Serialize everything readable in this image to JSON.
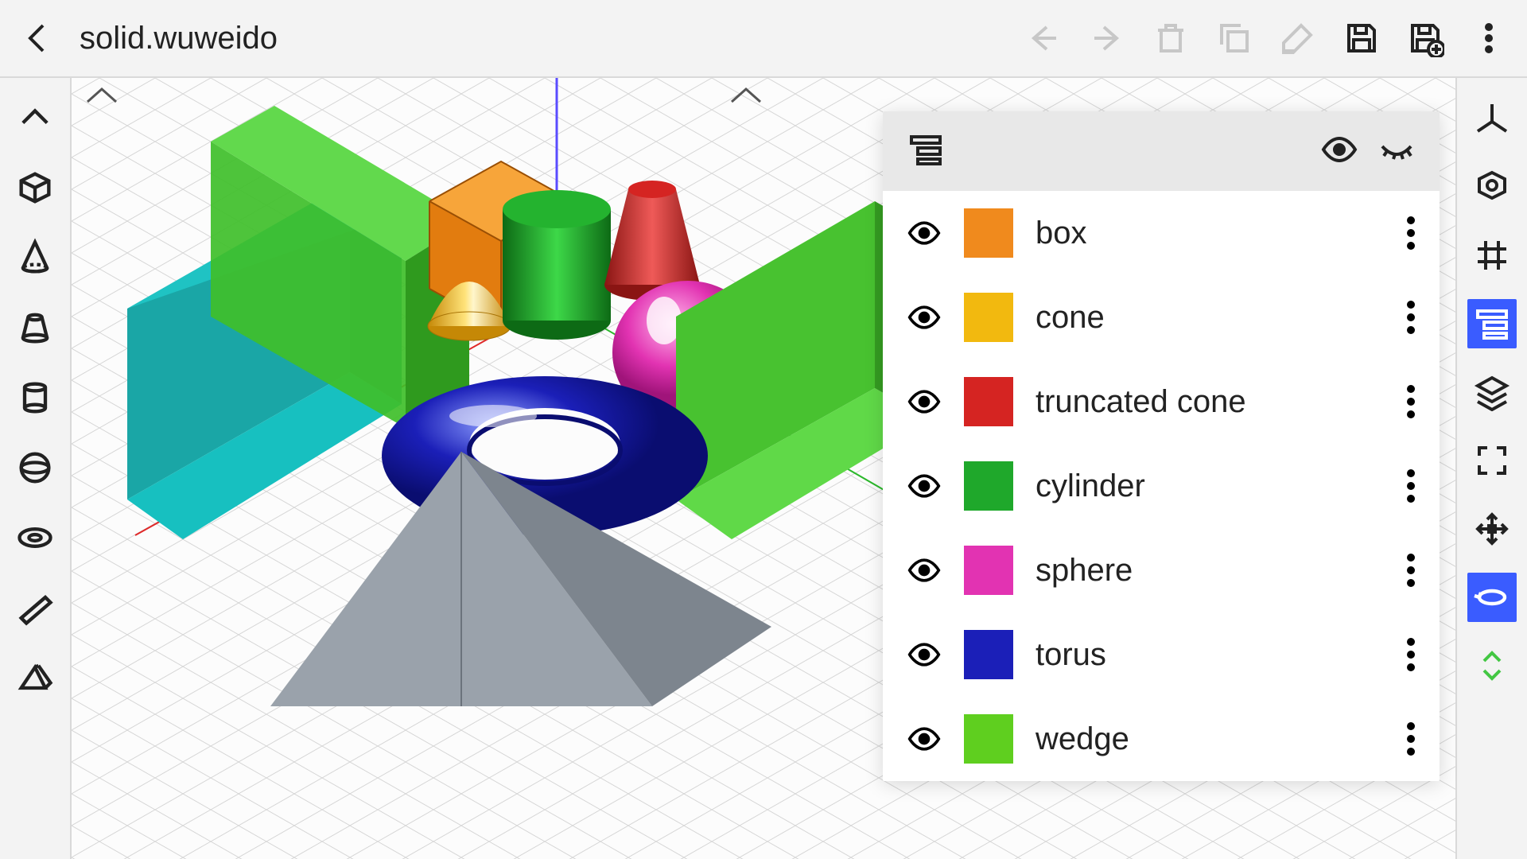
{
  "header": {
    "title": "solid.wuweido"
  },
  "toolbar_top": {
    "back": "back-icon",
    "undo": "undo-icon",
    "redo": "redo-icon",
    "delete": "trash-icon",
    "duplicate": "duplicate-icon",
    "edit": "edit-icon",
    "save": "save-icon",
    "save_as": "save-as-icon",
    "menu": "menu-icon"
  },
  "left_tools": [
    "collapse-up",
    "box-tool",
    "cone-tool",
    "truncated-cone-tool",
    "cylinder-tool",
    "sphere-tool",
    "torus-tool",
    "wedge-tool",
    "pyramid-tool"
  ],
  "right_tools": [
    {
      "name": "axes-tool",
      "active": false
    },
    {
      "name": "frame-tool",
      "active": false
    },
    {
      "name": "grid-tool",
      "active": false
    },
    {
      "name": "outline-tool",
      "active": true
    },
    {
      "name": "layers-tool",
      "active": false
    },
    {
      "name": "fullscreen-tool",
      "active": false
    },
    {
      "name": "move-tool",
      "active": false
    },
    {
      "name": "rotate-tool",
      "active": true
    },
    {
      "name": "scale-tool",
      "active": false
    }
  ],
  "panel": {
    "header_icons": {
      "tree": "tree-icon",
      "visible": "eye-icon",
      "hidden": "eye-closed-icon"
    },
    "items": [
      {
        "label": "box",
        "color": "#f08a1d"
      },
      {
        "label": "cone",
        "color": "#f2b90f"
      },
      {
        "label": "truncated cone",
        "color": "#d52422"
      },
      {
        "label": "cylinder",
        "color": "#1fa82b"
      },
      {
        "label": "sphere",
        "color": "#e233b2"
      },
      {
        "label": "torus",
        "color": "#1b1fb8"
      },
      {
        "label": "wedge",
        "color": "#5fcf1f"
      }
    ]
  }
}
